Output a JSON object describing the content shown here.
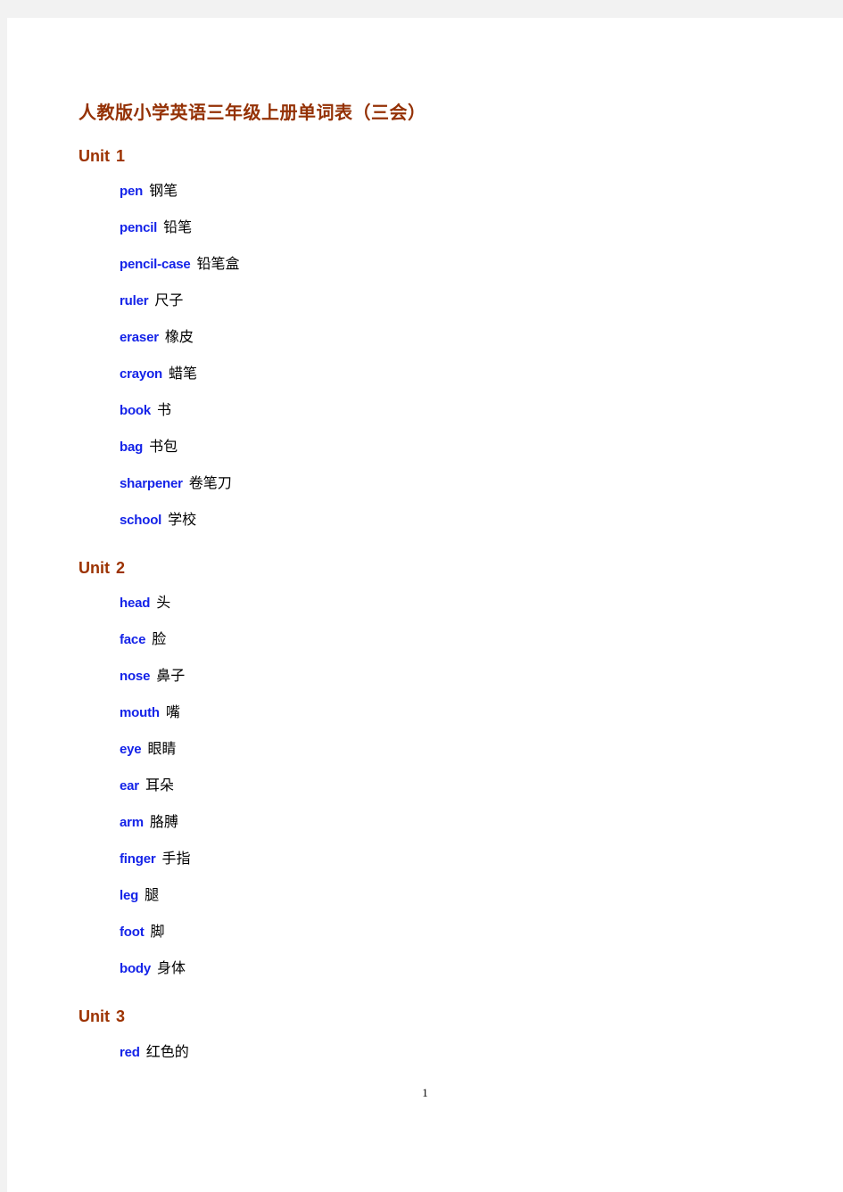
{
  "document": {
    "title": "人教版小学英语三年级上册单词表（三会）",
    "page_number": "1",
    "units": [
      {
        "label": "Unit",
        "number": "1",
        "words": [
          {
            "en": "pen",
            "zh": "钢笔"
          },
          {
            "en": "pencil",
            "zh": "铅笔"
          },
          {
            "en": "pencil-case",
            "zh": "铅笔盒"
          },
          {
            "en": "ruler",
            "zh": "尺子"
          },
          {
            "en": "eraser",
            "zh": "橡皮"
          },
          {
            "en": "crayon",
            "zh": "蜡笔"
          },
          {
            "en": "book",
            "zh": "书"
          },
          {
            "en": "bag",
            "zh": "书包"
          },
          {
            "en": "sharpener",
            "zh": "卷笔刀"
          },
          {
            "en": "school",
            "zh": "学校"
          }
        ]
      },
      {
        "label": "Unit",
        "number": "2",
        "words": [
          {
            "en": "head",
            "zh": "头"
          },
          {
            "en": "face",
            "zh": "脸"
          },
          {
            "en": "nose",
            "zh": "鼻子"
          },
          {
            "en": "mouth",
            "zh": "嘴"
          },
          {
            "en": "eye",
            "zh": "眼睛"
          },
          {
            "en": "ear",
            "zh": "耳朵"
          },
          {
            "en": "arm",
            "zh": "胳膊"
          },
          {
            "en": "finger",
            "zh": "手指"
          },
          {
            "en": "leg",
            "zh": "腿"
          },
          {
            "en": "foot",
            "zh": "脚"
          },
          {
            "en": "body",
            "zh": "身体"
          }
        ]
      },
      {
        "label": "Unit",
        "number": "3",
        "words": [
          {
            "en": "red",
            "zh": "红色的"
          }
        ]
      }
    ]
  },
  "colors": {
    "title": "#943105",
    "unit_heading": "#9c3200",
    "word_en": "#1423e8",
    "word_zh": "#000000",
    "page_background": "#ffffff",
    "canvas_background": "#f2f2f2"
  }
}
